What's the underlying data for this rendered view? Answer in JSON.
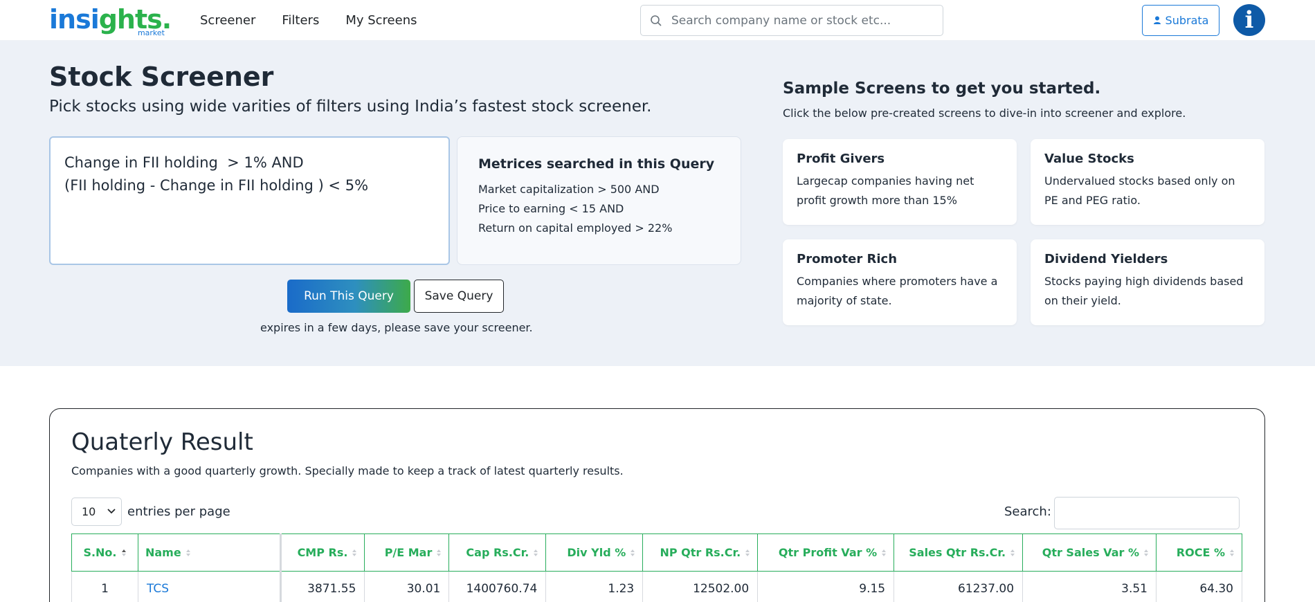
{
  "header": {
    "logo_main_a": "insi",
    "logo_main_b": "ghts.",
    "logo_sub": "market",
    "nav": [
      "Screener",
      "Filters",
      "My Screens"
    ],
    "search_placeholder": "Search company name or stock etc...",
    "user_name": "Subrata",
    "avatar_letter": "i"
  },
  "hero": {
    "title": "Stock Screener",
    "subtitle": "Pick stocks using wide varities of filters using India’s fastest stock screener.",
    "query_lines": [
      "Change in FII holding  > 1% AND",
      "(FII holding - Change in FII holding ) < 5%"
    ],
    "metrics_title": "Metrices searched in this Query",
    "metrics_lines": [
      "Market capitalization > 500 AND",
      "Price to earning < 15 AND",
      "Return on capital employed > 22%"
    ],
    "run_label": "Run This Query",
    "save_label": "Save Query",
    "expire_note": "expires in a few days, please save your screener."
  },
  "samples": {
    "title": "Sample Screens to get you started.",
    "subtitle": "Click the below pre-created screens to dive-in into screener and explore.",
    "cards": [
      {
        "title": "Profit Givers",
        "desc": "Largecap companies having net profit growth more than 15%"
      },
      {
        "title": "Value Stocks",
        "desc": "Undervalued stocks based only on PE and PEG ratio."
      },
      {
        "title": "Promoter Rich",
        "desc": "Companies where promoters have a majority of state."
      },
      {
        "title": "Dividend Yielders",
        "desc": "Stocks paying high dividends based on their yield."
      }
    ]
  },
  "result": {
    "title": "Quaterly Result",
    "subtitle": "Companies with a good quarterly growth. Specially made to keep a track of latest quarterly results.",
    "entries_value": "10",
    "entries_label": "entries per page",
    "search_label": "Search:",
    "columns": [
      "S.No.",
      "Name",
      "CMP Rs.",
      "P/E Mar",
      "Cap Rs.Cr.",
      "Div Yld %",
      "NP Qtr Rs.Cr.",
      "Qtr Profit Var %",
      "Sales Qtr Rs.Cr.",
      "Qtr Sales Var %",
      "ROCE %"
    ],
    "rows": [
      [
        "1",
        "TCS",
        "3871.55",
        "30.01",
        "1400760.74",
        "1.23",
        "12502.00",
        "9.15",
        "61237.00",
        "3.51",
        "64.30"
      ]
    ]
  },
  "colors": {
    "brand_blue": "#1a79d8",
    "brand_green": "#2bb24c",
    "table_header_green": "#27ad5b",
    "hero_bg": "#edf1f7"
  }
}
